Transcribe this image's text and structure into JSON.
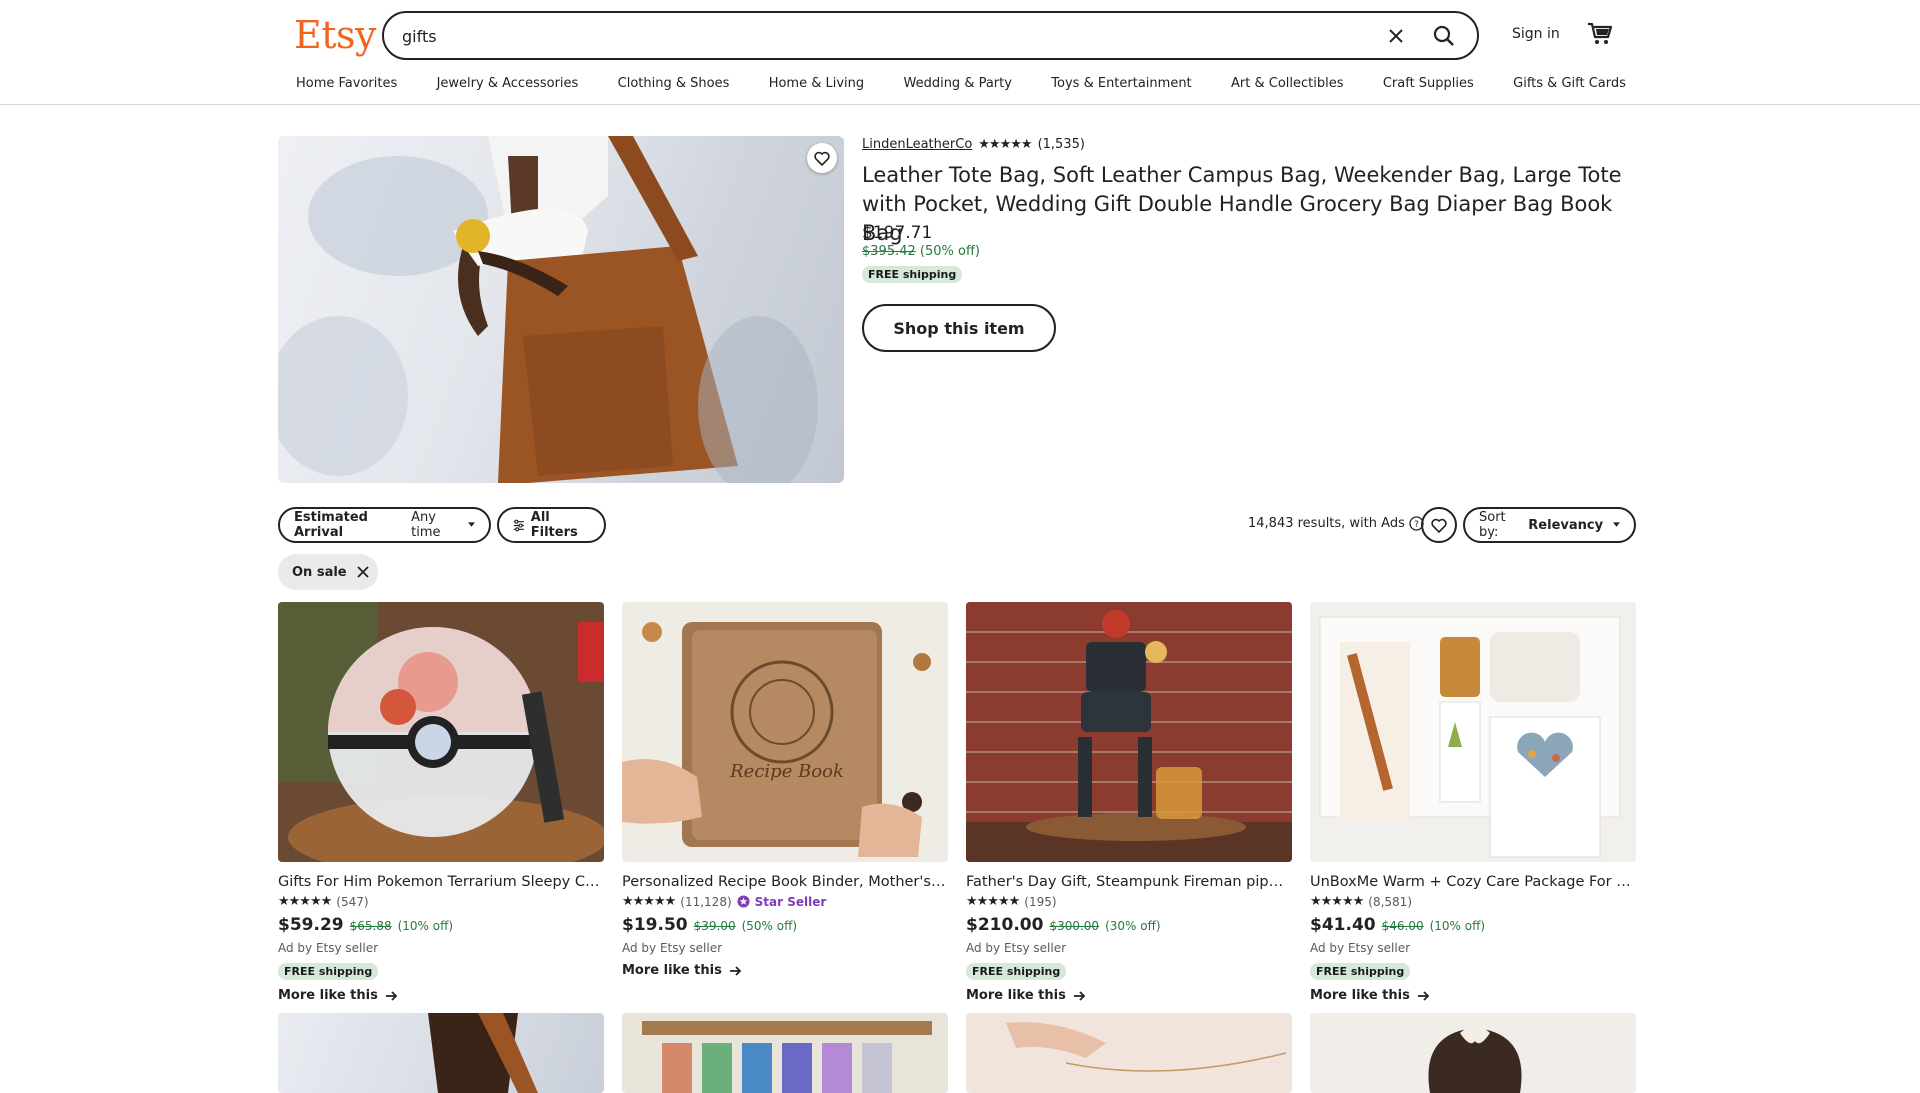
{
  "header": {
    "logo": "Etsy",
    "search_value": "gifts",
    "sign_in": "Sign in",
    "categories": [
      "Home Favorites",
      "Jewelry & Accessories",
      "Clothing & Shoes",
      "Home & Living",
      "Wedding & Party",
      "Toys & Entertainment",
      "Art & Collectibles",
      "Craft Supplies",
      "Gifts & Gift Cards"
    ]
  },
  "hero": {
    "seller": "LindenLeatherCo",
    "stars": "★★★★★",
    "review_count": "(1,535)",
    "title": "Leather Tote Bag, Soft Leather Campus Bag, Weekender Bag, Large Tote with Pocket, Wedding Gift Double Handle Grocery Bag Diaper Bag Book Bag",
    "price": "$197.71",
    "original_price": "$395.42",
    "discount": "(50% off)",
    "shipping": "FREE shipping",
    "cta": "Shop this item"
  },
  "filters": {
    "arrival_label": "Estimated Arrival",
    "arrival_value": "Any time",
    "all_filters": "All Filters",
    "results_text": "14,843 results, with Ads",
    "sort_label": "Sort by:",
    "sort_value": "Relevancy",
    "active_filter": "On sale"
  },
  "listings": [
    {
      "title": "Gifts For Him Pokemon Terrarium Sleepy Charmander",
      "stars": "★★★★★",
      "reviews": "(547)",
      "star_seller": "",
      "price": "$59.29",
      "old_price": "$65.88",
      "discount": "(10% off)",
      "ad": "Ad by Etsy seller",
      "shipping": "FREE shipping",
      "more": "More like this"
    },
    {
      "title": "Personalized Recipe Book Binder, Mother's Day Gift",
      "stars": "★★★★★",
      "reviews": "(11,128)",
      "star_seller": "Star Seller",
      "price": "$19.50",
      "old_price": "$39.00",
      "discount": "(50% off)",
      "ad": "Ad by Etsy seller",
      "shipping": "",
      "more": "More like this"
    },
    {
      "title": "Father's Day Gift, Steampunk Fireman pipe Robot",
      "stars": "★★★★★",
      "reviews": "(195)",
      "star_seller": "",
      "price": "$210.00",
      "old_price": "$300.00",
      "discount": "(30% off)",
      "ad": "Ad by Etsy seller",
      "shipping": "FREE shipping",
      "more": "More like this"
    },
    {
      "title": "UnBoxMe Warm + Cozy Care Package For Her, Gift Box",
      "stars": "★★★★★",
      "reviews": "(8,581)",
      "star_seller": "",
      "price": "$41.40",
      "old_price": "$46.00",
      "discount": "(10% off)",
      "ad": "Ad by Etsy seller",
      "shipping": "FREE shipping",
      "more": "More like this"
    }
  ],
  "colors": {
    "brand": "#f1641e",
    "sale_green": "#257a3e",
    "badge_green": "#d4e9d7"
  }
}
